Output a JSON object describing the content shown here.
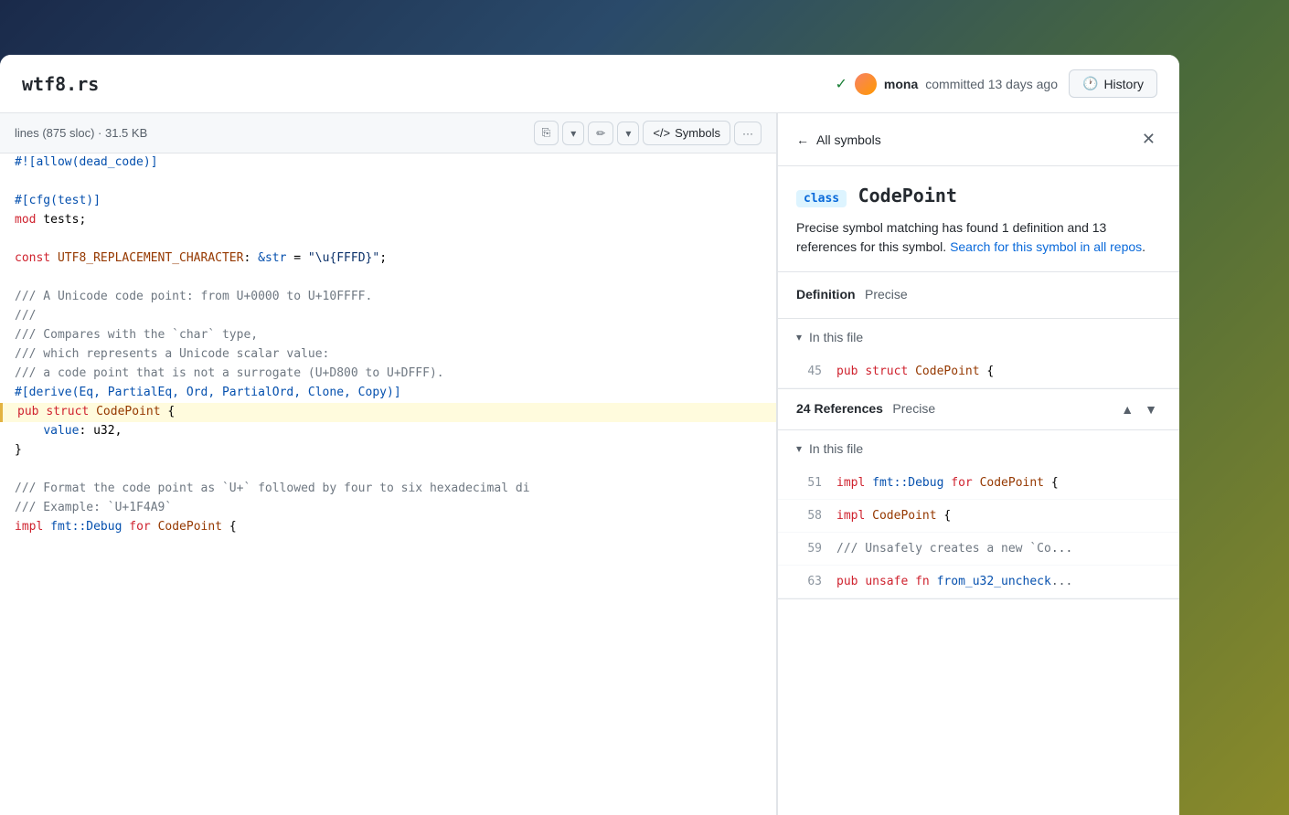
{
  "header": {
    "file_title": "wtf8.rs",
    "commit_author": "mona",
    "commit_message": "committed 13 days ago",
    "history_label": "History",
    "check_symbol": "✓"
  },
  "toolbar": {
    "file_info": "lines (875 sloc) · 31.5 KB",
    "symbols_label": "Symbols",
    "more_label": "···"
  },
  "symbols_panel": {
    "back_label": "All symbols",
    "symbol_kind": "class",
    "symbol_name": "CodePoint",
    "description_text": "Precise symbol matching has found 1 definition and 13 references for this symbol.",
    "search_link": "Search for this symbol in all repos",
    "definition_label": "Definition",
    "definition_type": "Precise",
    "in_this_file_label": "In this file",
    "definition_line": "45",
    "definition_code": "pub struct CodePoint {",
    "references_count": "24",
    "references_label": "References",
    "references_type": "Precise",
    "refs_in_file_label": "In this file",
    "ref_items": [
      {
        "line": "51",
        "code": "impl fmt::Debug for CodePoint {"
      },
      {
        "line": "58",
        "code": "impl CodePoint {"
      },
      {
        "line": "59",
        "code": "/// Unsafely creates a new `Co..."
      },
      {
        "line": "63",
        "code": "pub unsafe fn from_u32_uncheck..."
      }
    ]
  },
  "code_lines": [
    {
      "num": "",
      "code": "#![allow(dead_code)]",
      "type": "attr",
      "highlighted": false
    },
    {
      "num": "",
      "code": "",
      "type": "blank",
      "highlighted": false
    },
    {
      "num": "",
      "code": "#[cfg(test)]",
      "type": "attr",
      "highlighted": false
    },
    {
      "num": "",
      "code": "mod tests;",
      "type": "normal",
      "highlighted": false
    },
    {
      "num": "",
      "code": "",
      "type": "blank",
      "highlighted": false
    },
    {
      "num": "",
      "code": "const UTF8_REPLACEMENT_CHARACTER: &str = \"\\u{FFFD}\";",
      "type": "const",
      "highlighted": false
    },
    {
      "num": "",
      "code": "",
      "type": "blank",
      "highlighted": false
    },
    {
      "num": "",
      "code": "/// A Unicode code point: from U+0000 to U+10FFFF.",
      "type": "comment",
      "highlighted": false
    },
    {
      "num": "",
      "code": "///",
      "type": "comment",
      "highlighted": false
    },
    {
      "num": "",
      "code": "/// Compares with the `char` type,",
      "type": "comment",
      "highlighted": false
    },
    {
      "num": "",
      "code": "/// which represents a Unicode scalar value:",
      "type": "comment",
      "highlighted": false
    },
    {
      "num": "",
      "code": "/// a code point that is not a surrogate (U+D800 to U+DFFF).",
      "type": "comment",
      "highlighted": false
    },
    {
      "num": "",
      "code": "#[derive(Eq, PartialEq, Ord, PartialOrd, Clone, Copy)]",
      "type": "attr",
      "highlighted": false
    },
    {
      "num": "",
      "code": "pub struct CodePoint {",
      "type": "struct",
      "highlighted": true
    },
    {
      "num": "",
      "code": "    value: u32,",
      "type": "field",
      "highlighted": false
    },
    {
      "num": "",
      "code": "}",
      "type": "normal",
      "highlighted": false
    },
    {
      "num": "",
      "code": "",
      "type": "blank",
      "highlighted": false
    },
    {
      "num": "",
      "code": "/// Format the code point as `U+` followed by four to six hexadecimal di",
      "type": "comment",
      "highlighted": false
    },
    {
      "num": "",
      "code": "/// Example: `U+1F4A9`",
      "type": "comment",
      "highlighted": false
    },
    {
      "num": "",
      "code": "impl fmt::Debug for CodePoint {",
      "type": "impl",
      "highlighted": false
    }
  ]
}
